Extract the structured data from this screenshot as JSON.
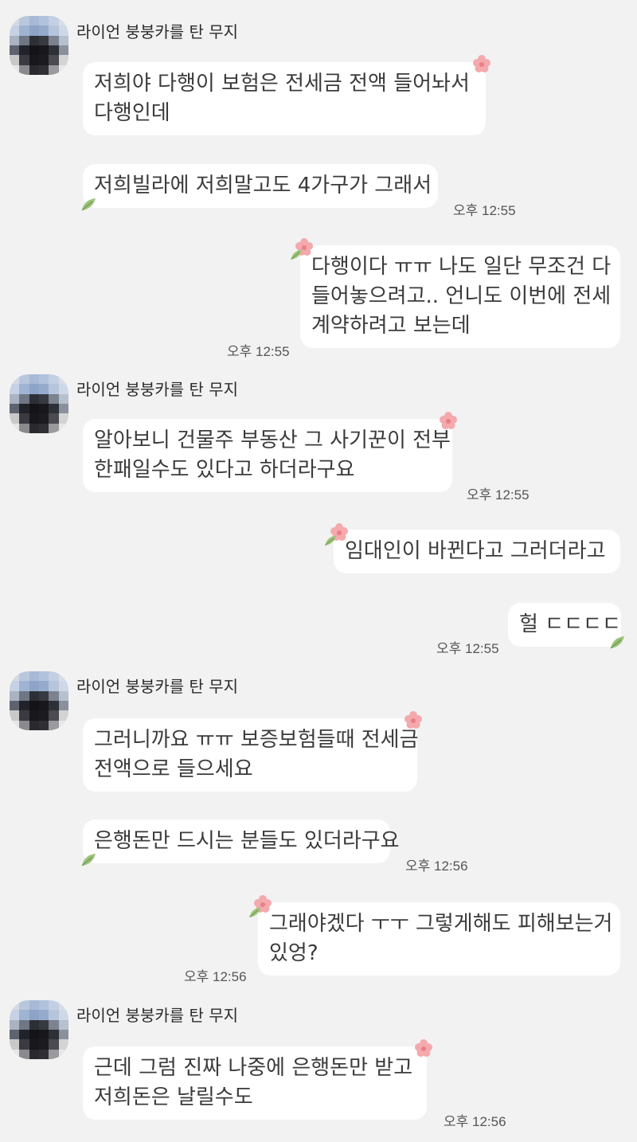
{
  "sender_name": "라이언 붕붕카를 탄 무지",
  "messages": {
    "m1": {
      "line1": "저희야 다행이 보험은 전세금 전액 들어놔서",
      "line2": "다행인데"
    },
    "m2": {
      "line1": "저희빌라에 저희말고도 4가구가 그래서",
      "time": "오후 12:55"
    },
    "m3": {
      "line1": "다행이다 ㅠㅠ 나도 일단 무조건 다",
      "line2": "들어놓으려고.. 언니도 이번에 전세",
      "line3": "계약하려고 보는데",
      "time": "오후 12:55"
    },
    "m4": {
      "line1": "알아보니 건물주 부동산 그 사기꾼이 전부",
      "line2": "한패일수도 있다고 하더라구요",
      "time": "오후 12:55"
    },
    "m5": {
      "line1": "임대인이 바뀐다고 그러더라고"
    },
    "m6": {
      "line1": "헐 ㄷㄷㄷㄷ",
      "time": "오후 12:55"
    },
    "m7": {
      "line1": "그러니까요 ㅠㅠ 보증보험들때 전세금",
      "line2": "전액으로 들으세요"
    },
    "m8": {
      "line1": "은행돈만 드시는 분들도 있더라구요",
      "time": "오후 12:56"
    },
    "m9": {
      "line1": "그래야겠다 ㅜㅜ 그렇게해도 피해보는거",
      "line2": "있엉?",
      "time": "오후 12:56"
    },
    "m10": {
      "line1": "근데 그럼 진짜 나중에 은행돈만 받고",
      "line2": "저희돈은 날릴수도",
      "time": "오후 12:56"
    }
  },
  "icons": {
    "bubble_flower": "pink-flower-icon",
    "bubble_leaf": "green-leaf-icon"
  },
  "colors": {
    "background": "#f2f2f2",
    "bubble": "#ffffff",
    "flower": "#f2a3a8",
    "leaf": "#8fb86a"
  }
}
